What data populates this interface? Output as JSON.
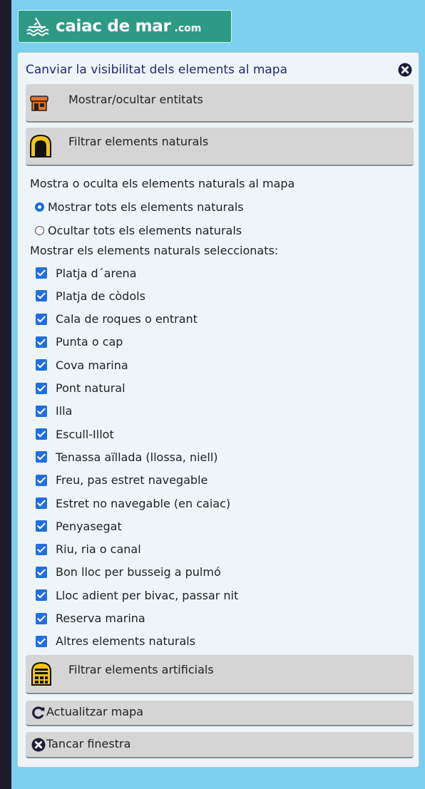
{
  "logo": {
    "name": "caiac de mar",
    "tld": ".com"
  },
  "panel": {
    "title": "Canviar la visibilitat dels elements al mapa",
    "buttons": {
      "entities": "Mostrar/ocultar entitats",
      "natural": "Filtrar elements naturals",
      "artificial": "Filtrar elements artificials",
      "refresh": "Actualitzar mapa",
      "close": "Tancar finestra"
    },
    "description": "Mostra o oculta els elements naturals al mapa",
    "radios": [
      {
        "label": "Mostrar tots els elements naturals",
        "checked": true
      },
      {
        "label": "Ocultar tots els elements naturals",
        "checked": false
      }
    ],
    "selected_label": "Mostrar els elements naturals seleccionats:",
    "items": [
      {
        "label": "Platja d´arena",
        "checked": true
      },
      {
        "label": "Platja de còdols",
        "checked": true
      },
      {
        "label": "Cala de roques o entrant",
        "checked": true
      },
      {
        "label": "Punta o cap",
        "checked": true
      },
      {
        "label": "Cova marina",
        "checked": true
      },
      {
        "label": "Pont natural",
        "checked": true
      },
      {
        "label": "Illa",
        "checked": true
      },
      {
        "label": "Escull-Illot",
        "checked": true
      },
      {
        "label": "Tenassa aïllada (llossa, niell)",
        "checked": true
      },
      {
        "label": "Freu, pas estret navegable",
        "checked": true
      },
      {
        "label": "Estret no navegable (en caiac)",
        "checked": true
      },
      {
        "label": "Penyasegat",
        "checked": true
      },
      {
        "label": "Riu, ria o canal",
        "checked": true
      },
      {
        "label": "Bon lloc per busseig a pulmó",
        "checked": true
      },
      {
        "label": "Lloc adient per bivac, passar nit",
        "checked": true
      },
      {
        "label": "Reserva marina",
        "checked": true
      },
      {
        "label": "Altres elements naturals",
        "checked": true
      }
    ]
  },
  "colors": {
    "page_bg": "#1c1b27",
    "frame_bg": "#7ccfee",
    "logo_bg": "#2e9a86",
    "panel_bg": "#eef5f9",
    "title_color": "#202a70",
    "button_bg": "#d5d5d5",
    "checkbox_accent": "#1f6fe0"
  },
  "icons": {
    "logo": "kayak-waves-icon",
    "close": "close-circle-icon",
    "entities": "shop-icon",
    "natural": "cave-arch-icon",
    "artificial": "lighthouse-building-icon",
    "refresh": "refresh-icon",
    "close_window": "close-circle-icon"
  }
}
